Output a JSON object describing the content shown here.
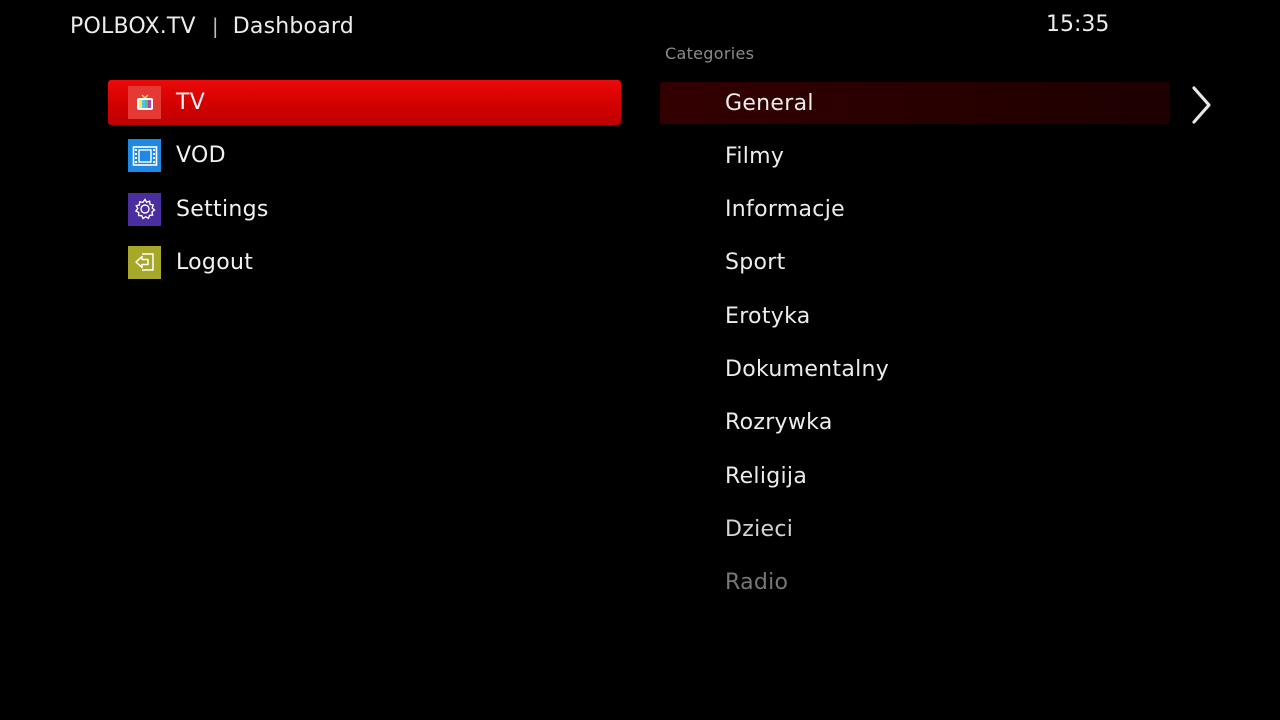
{
  "header": {
    "brand": "POLBOX.TV",
    "separator": "|",
    "title": "Dashboard",
    "clock": "15:35"
  },
  "menu": {
    "items": [
      {
        "label": "TV",
        "icon": "tv-icon",
        "color": "#e53935",
        "selected": true
      },
      {
        "label": "VOD",
        "icon": "film-icon",
        "color": "#1e88e5",
        "selected": false
      },
      {
        "label": "Settings",
        "icon": "gear-icon",
        "color": "#4a2ea0",
        "selected": false
      },
      {
        "label": "Logout",
        "icon": "logout-icon",
        "color": "#a7a72a",
        "selected": false
      }
    ]
  },
  "categories": {
    "title": "Categories",
    "items": [
      {
        "label": "General",
        "selected": true
      },
      {
        "label": "Filmy"
      },
      {
        "label": "Informacje"
      },
      {
        "label": "Sport"
      },
      {
        "label": "Erotyka"
      },
      {
        "label": "Dokumentalny"
      },
      {
        "label": "Rozrywka"
      },
      {
        "label": "Religija"
      },
      {
        "label": "Dzieci"
      },
      {
        "label": "Radio"
      }
    ]
  },
  "colors": {
    "accent": "#d30000",
    "background": "#000000",
    "selected_category_bg": "#2a0000"
  }
}
